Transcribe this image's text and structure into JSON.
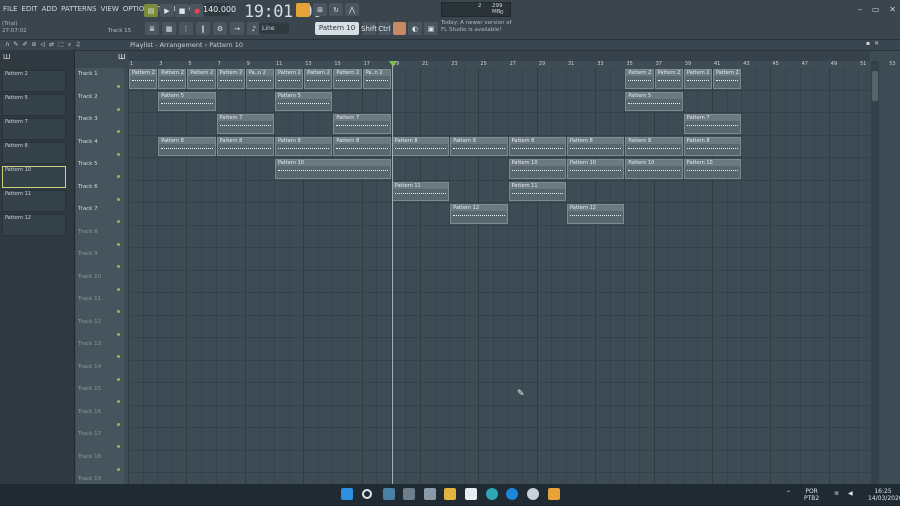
{
  "menu": [
    "FILE",
    "EDIT",
    "ADD",
    "PATTERNS",
    "VIEW",
    "OPTIONS",
    "TOOLS",
    "HELP"
  ],
  "transport": {
    "tempo": "140.000",
    "time": "19:01:00",
    "time_unit": "B:S:T",
    "hint_mode": "(Trial)",
    "hint_time": "27:07:02",
    "hint_track": "Track 15"
  },
  "cpu": {
    "cores": "2",
    "mem": "299 MB",
    "val": "0"
  },
  "snap": "Line",
  "pattern_selector": "Pattern 10",
  "shift_label": "Shift",
  "ctrl_label": "Ctrl",
  "news": [
    "Today: A newer version of",
    "FL Studio is available!"
  ],
  "playlist": {
    "title": "Playlist - Arrangement",
    "sep": "›",
    "current": "Pattern 10"
  },
  "browser_items": [
    "Pattern 2",
    "Pattern 5",
    "Pattern 7",
    "Pattern 8",
    "Pattern 10",
    "Pattern 11",
    "Pattern 12"
  ],
  "tracks": [
    "Track 1",
    "Track 2",
    "Track 3",
    "Track 4",
    "Track 5",
    "Track 6",
    "Track 7",
    "Track 8",
    "Track 9",
    "Track 10",
    "Track 11",
    "Track 12",
    "Track 13",
    "Track 14",
    "Track 15",
    "Track 16",
    "Track 17",
    "Track 18",
    "Track 19"
  ],
  "ruler_numbers": [
    "1",
    "3",
    "5",
    "7",
    "9",
    "11",
    "13",
    "15",
    "17",
    "19",
    "21",
    "23",
    "25",
    "27",
    "29",
    "31",
    "33",
    "35",
    "37",
    "39",
    "41",
    "43",
    "45",
    "47",
    "49",
    "51",
    "53"
  ],
  "clips": [
    {
      "t": 0,
      "b": 1,
      "len": 2,
      "n": "Pattern 2"
    },
    {
      "t": 0,
      "b": 3,
      "len": 2,
      "n": "Pattern 2"
    },
    {
      "t": 0,
      "b": 5,
      "len": 2,
      "n": "Pattern 2"
    },
    {
      "t": 0,
      "b": 7,
      "len": 2,
      "n": "Pattern 2"
    },
    {
      "t": 0,
      "b": 9,
      "len": 2,
      "n": "Pa..n 2"
    },
    {
      "t": 0,
      "b": 11,
      "len": 2,
      "n": "Pattern 2"
    },
    {
      "t": 0,
      "b": 13,
      "len": 2,
      "n": "Pattern 2"
    },
    {
      "t": 0,
      "b": 15,
      "len": 2,
      "n": "Pattern 2"
    },
    {
      "t": 0,
      "b": 17,
      "len": 2,
      "n": "Pa..n 2"
    },
    {
      "t": 0,
      "b": 35,
      "len": 2,
      "n": "Pattern 2"
    },
    {
      "t": 0,
      "b": 37,
      "len": 2,
      "n": "Pattern 2"
    },
    {
      "t": 0,
      "b": 39,
      "len": 2,
      "n": "Pattern 2"
    },
    {
      "t": 0,
      "b": 41,
      "len": 2,
      "n": "Pattern 2"
    },
    {
      "t": 1,
      "b": 3,
      "len": 4,
      "n": "Pattern 5"
    },
    {
      "t": 1,
      "b": 11,
      "len": 4,
      "n": "Pattern 5"
    },
    {
      "t": 1,
      "b": 35,
      "len": 4,
      "n": "Pattern 5"
    },
    {
      "t": 2,
      "b": 7,
      "len": 4,
      "n": "Pattern 7"
    },
    {
      "t": 2,
      "b": 15,
      "len": 4,
      "n": "Pattern 7"
    },
    {
      "t": 2,
      "b": 39,
      "len": 4,
      "n": "Pattern 7"
    },
    {
      "t": 3,
      "b": 3,
      "len": 4,
      "n": "Pattern 8"
    },
    {
      "t": 3,
      "b": 7,
      "len": 4,
      "n": "Pattern 8"
    },
    {
      "t": 3,
      "b": 11,
      "len": 4,
      "n": "Pattern 8"
    },
    {
      "t": 3,
      "b": 15,
      "len": 4,
      "n": "Pattern 8"
    },
    {
      "t": 3,
      "b": 19,
      "len": 4,
      "n": "Pattern 8"
    },
    {
      "t": 3,
      "b": 23,
      "len": 4,
      "n": "Pattern 8"
    },
    {
      "t": 3,
      "b": 27,
      "len": 4,
      "n": "Pattern 8"
    },
    {
      "t": 3,
      "b": 31,
      "len": 4,
      "n": "Pattern 8"
    },
    {
      "t": 3,
      "b": 35,
      "len": 4,
      "n": "Pattern 8"
    },
    {
      "t": 3,
      "b": 39,
      "len": 4,
      "n": "Pattern 8"
    },
    {
      "t": 4,
      "b": 11,
      "len": 8,
      "n": "Pattern 10"
    },
    {
      "t": 4,
      "b": 27,
      "len": 4,
      "n": "Pattern 10"
    },
    {
      "t": 4,
      "b": 31,
      "len": 4,
      "n": "Pattern 10"
    },
    {
      "t": 4,
      "b": 35,
      "len": 4,
      "n": "Pattern 10"
    },
    {
      "t": 4,
      "b": 39,
      "len": 4,
      "n": "Pattern 10"
    },
    {
      "t": 5,
      "b": 19,
      "len": 4,
      "n": "Pattern 11"
    },
    {
      "t": 5,
      "b": 27,
      "len": 4,
      "n": "Pattern 11"
    },
    {
      "t": 6,
      "b": 23,
      "len": 4,
      "n": "Pattern 12"
    },
    {
      "t": 6,
      "b": 31,
      "len": 4,
      "n": "Pattern 12"
    }
  ],
  "taskbar": {
    "lang1": "POR",
    "lang2": "PTB2",
    "time": "16:25",
    "date": "14/03/2026"
  },
  "colors": {
    "bg": "#3d4b55",
    "clip": "#58666e",
    "accent": "#e8a23a",
    "play": "#7ac34a"
  }
}
